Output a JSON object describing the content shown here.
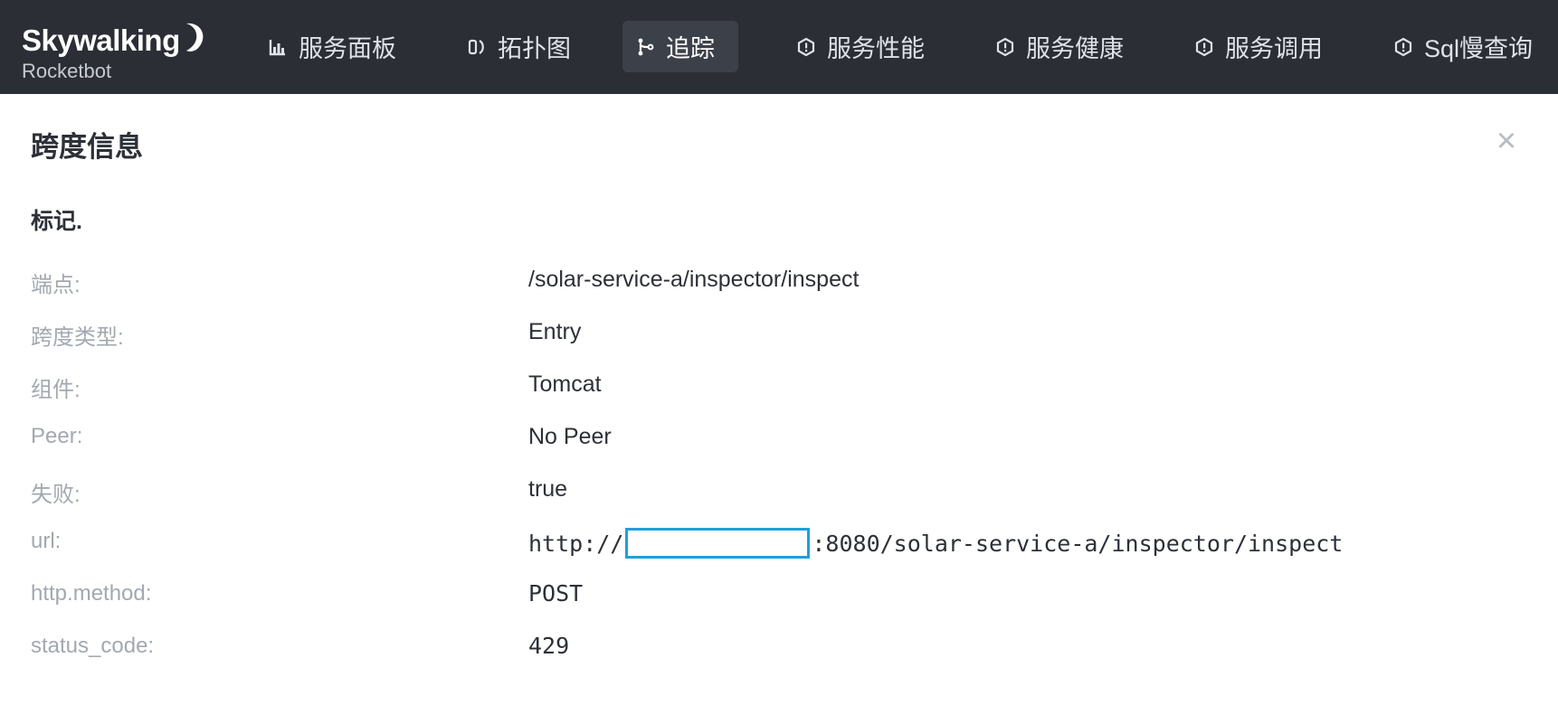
{
  "brand": {
    "name": "Skywalking",
    "subtitle": "Rocketbot"
  },
  "nav": {
    "items": [
      {
        "label": "服务面板",
        "icon": "bar-chart-icon",
        "active": false
      },
      {
        "label": "拓扑图",
        "icon": "topology-icon",
        "active": false
      },
      {
        "label": "追踪",
        "icon": "trace-icon",
        "active": true
      },
      {
        "label": "服务性能",
        "icon": "hexagon-alert-icon",
        "active": false
      },
      {
        "label": "服务健康",
        "icon": "hexagon-alert-icon",
        "active": false
      },
      {
        "label": "服务调用",
        "icon": "hexagon-alert-icon",
        "active": false
      },
      {
        "label": "Sql慢查询",
        "icon": "hexagon-alert-icon",
        "active": false
      }
    ]
  },
  "panel": {
    "title": "跨度信息",
    "close_label": "×",
    "section_title": "标记."
  },
  "rows": [
    {
      "label": "端点:",
      "value": "/solar-service-a/inspector/inspect"
    },
    {
      "label": "跨度类型:",
      "value": "Entry"
    },
    {
      "label": "组件:",
      "value": "Tomcat"
    },
    {
      "label": "Peer:",
      "value": "No Peer"
    },
    {
      "label": "失败:",
      "value": "true"
    },
    {
      "label": "url:",
      "value_prefix": "http://",
      "value_suffix": ":8080/solar-service-a/inspector/inspect"
    },
    {
      "label": "http.method:",
      "value": "POST"
    },
    {
      "label": "status_code:",
      "value": "429"
    }
  ],
  "colors": {
    "topbar_bg": "#2b2e35",
    "active_tab_bg": "#3c4049",
    "label_gray": "#a3a8b1",
    "value_dark": "#2d3038",
    "redaction_border": "#1ea0db"
  }
}
